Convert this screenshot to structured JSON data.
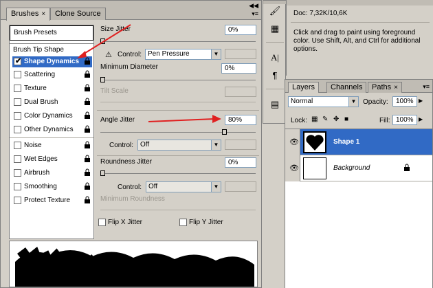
{
  "brushes_panel": {
    "tabs": [
      "Brushes",
      "Clone Source"
    ],
    "tab_close": "×",
    "brush_presets": "Brush Presets",
    "brush_tip_shape": "Brush Tip Shape",
    "options": [
      {
        "label": "Shape Dynamics",
        "checked": true,
        "selected": true
      },
      {
        "label": "Scattering",
        "checked": false
      },
      {
        "label": "Texture",
        "checked": false
      },
      {
        "label": "Dual Brush",
        "checked": false
      },
      {
        "label": "Color Dynamics",
        "checked": false
      },
      {
        "label": "Other Dynamics",
        "checked": false
      },
      {
        "label": "Noise",
        "checked": false
      },
      {
        "label": "Wet Edges",
        "checked": false
      },
      {
        "label": "Airbrush",
        "checked": false
      },
      {
        "label": "Smoothing",
        "checked": false
      },
      {
        "label": "Protect Texture",
        "checked": false
      }
    ],
    "size_jitter": {
      "label": "Size Jitter",
      "value": "0%"
    },
    "control_1": {
      "label": "Control:",
      "value": "Pen Pressure"
    },
    "minimum_diameter": {
      "label": "Minimum Diameter",
      "value": "0%"
    },
    "tilt_scale": {
      "label": "Tilt Scale"
    },
    "angle_jitter": {
      "label": "Angle Jitter",
      "value": "80%",
      "slider_level": 0.8
    },
    "control_2": {
      "label": "Control:",
      "value": "Off"
    },
    "roundness_jitter": {
      "label": "Roundness Jitter",
      "value": "0%"
    },
    "control_3": {
      "label": "Control:",
      "value": "Off"
    },
    "minimum_roundness": {
      "label": "Minimum Roundness"
    },
    "flip_x": "Flip X Jitter",
    "flip_y": "Flip Y Jitter"
  },
  "info_panel": {
    "doc": "Doc: 7,32K/10,6K",
    "hint": "Click and drag to paint using foreground color.  Use Shift, Alt, and Ctrl for additional options."
  },
  "layers_panel": {
    "tabs": [
      "Layers",
      "Channels",
      "Paths"
    ],
    "tab_close": "×",
    "blend_mode": "Normal",
    "opacity_label": "Opacity:",
    "opacity": "100%",
    "lock_label": "Lock:",
    "fill_label": "Fill:",
    "fill": "100%",
    "layers": [
      {
        "name": "Shape 1",
        "selected": true
      },
      {
        "name": "Background",
        "selected": false
      }
    ]
  },
  "toolstrip": {
    "icons": [
      "brush-tool-icon",
      "clone-stamp-icon",
      "character-icon",
      "paragraph-icon",
      "notes-icon"
    ],
    "glyphs": [
      "🖌",
      "▦",
      "A|",
      "¶",
      "▤"
    ]
  },
  "colors": {
    "selection": "#316ac5",
    "panel": "#d4d0c8",
    "annotation_arrow": "#e02020"
  }
}
